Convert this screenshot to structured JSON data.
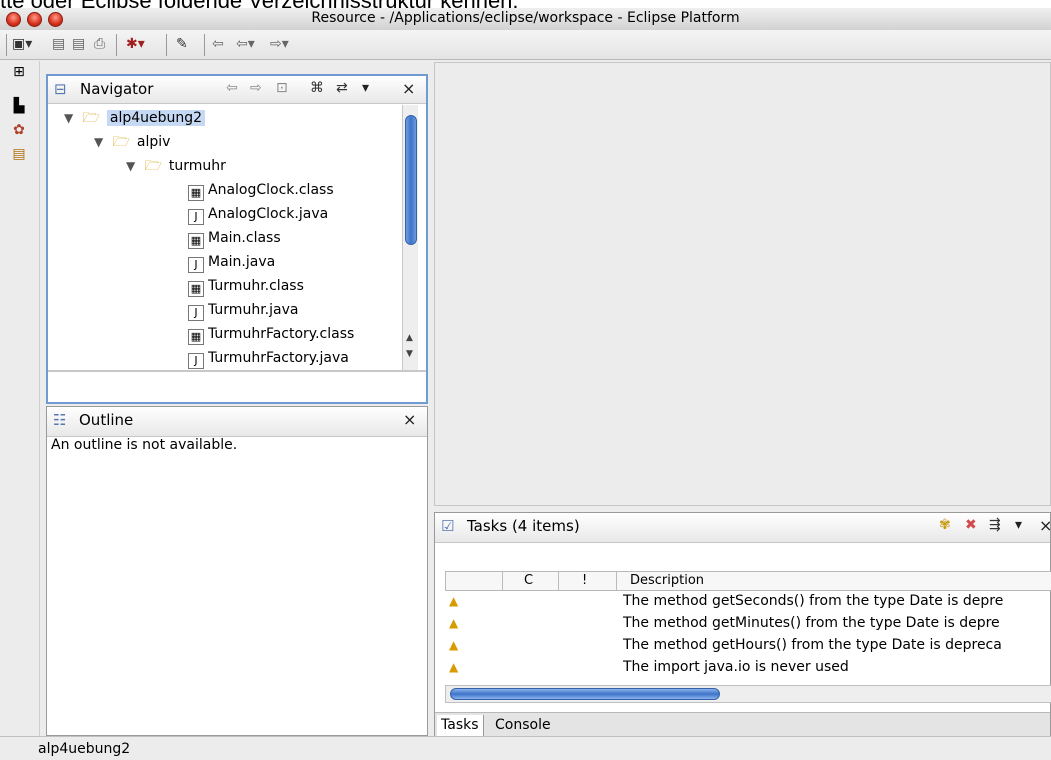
{
  "caption": "tte oder Eclipse folgende Verzeichnisstruktur kennen:",
  "window": {
    "title": "Resource - /Applications/eclipse/workspace - Eclipse Platform"
  },
  "navigator": {
    "title": "Navigator",
    "close": "×",
    "tree": [
      {
        "label": "alp4uebung2",
        "kind": "project"
      },
      {
        "label": "alpiv",
        "kind": "folder"
      },
      {
        "label": "turmuhr",
        "kind": "folder"
      },
      {
        "label": "AnalogClock.class",
        "kind": "class"
      },
      {
        "label": "AnalogClock.java",
        "kind": "java"
      },
      {
        "label": "Main.class",
        "kind": "class"
      },
      {
        "label": "Main.java",
        "kind": "java"
      },
      {
        "label": "Turmuhr.class",
        "kind": "class"
      },
      {
        "label": "Turmuhr.java",
        "kind": "java"
      },
      {
        "label": "TurmuhrFactory.class",
        "kind": "class"
      },
      {
        "label": "TurmuhrFactory.java",
        "kind": "java"
      }
    ]
  },
  "outline": {
    "title": "Outline",
    "close": "×",
    "message": "An outline is not available."
  },
  "tasks": {
    "title": "Tasks (4 items)",
    "close": "×",
    "columns": [
      "C",
      "!",
      "Description"
    ],
    "rows": [
      "The method getSeconds() from the type Date is depre",
      "The method getMinutes() from the type Date is depre",
      "The method getHours() from the type Date is depreca",
      "The import java.io is never used"
    ],
    "tabs": [
      "Tasks",
      "Console"
    ]
  },
  "status": {
    "text": "alp4uebung2"
  }
}
